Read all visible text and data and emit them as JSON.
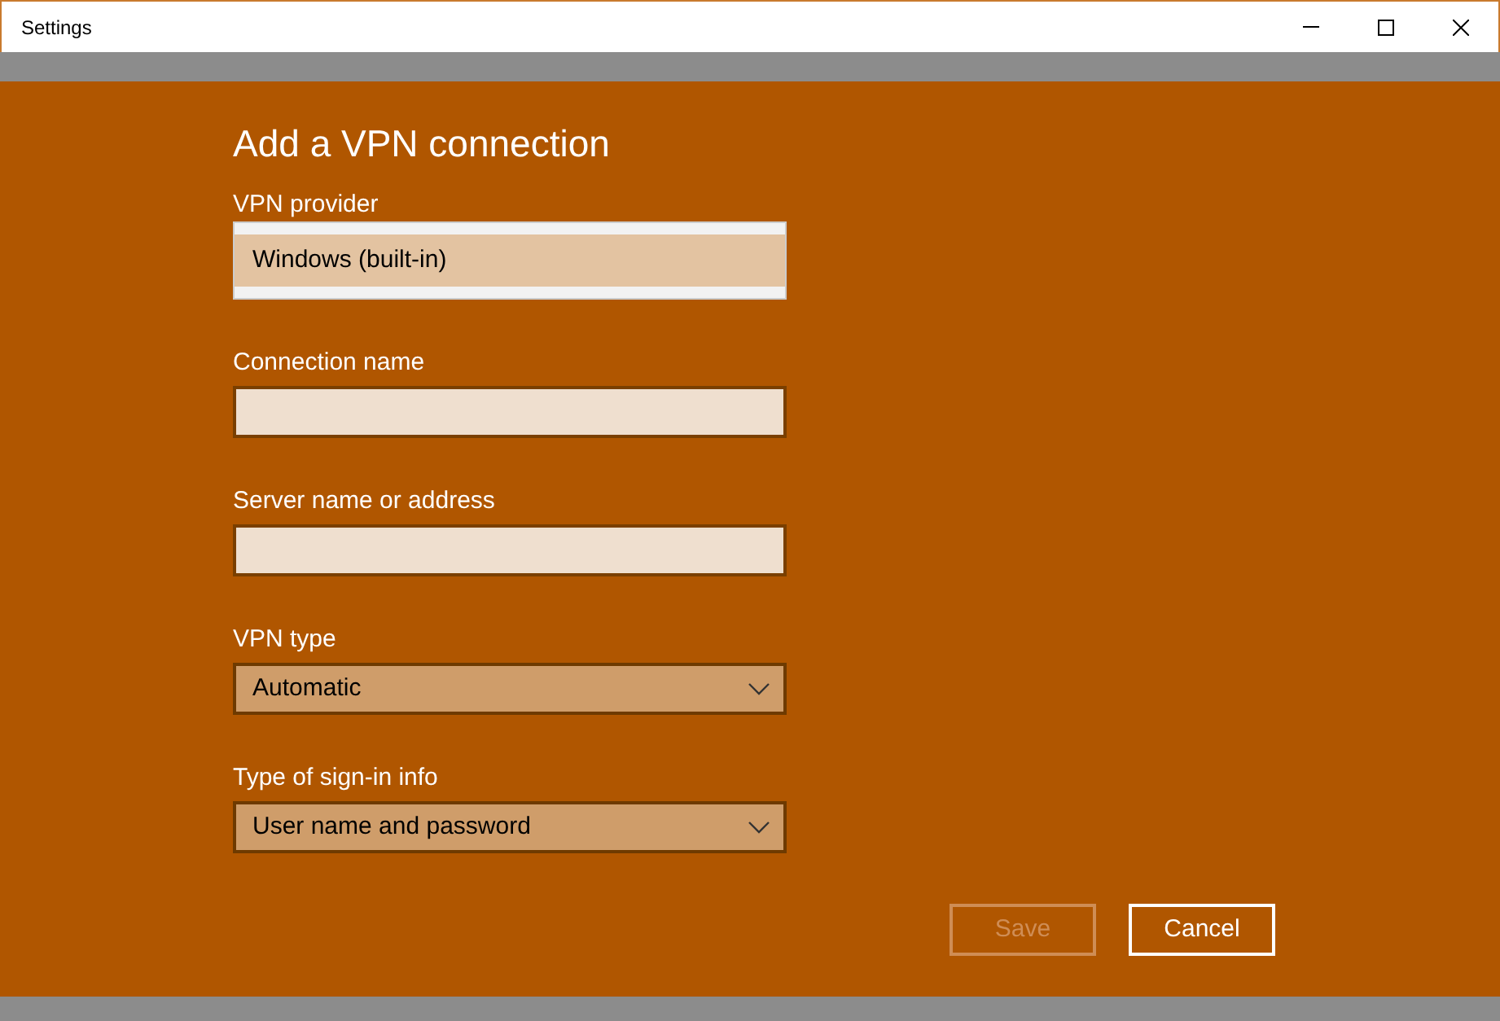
{
  "window": {
    "title": "Settings"
  },
  "heading": "Add a VPN connection",
  "fields": [
    {
      "kind": "list",
      "label": "VPN provider",
      "options": [
        {
          "label": "Windows (built-in)",
          "selected": true
        }
      ]
    },
    {
      "kind": "text",
      "label": "Connection name"
    },
    {
      "kind": "text",
      "label": "Server name or address"
    },
    {
      "kind": "select",
      "label": "VPN type",
      "value": "Automatic"
    },
    {
      "kind": "select",
      "label": "Type of sign-in info",
      "value": "User name and password"
    }
  ],
  "buttons": [
    {
      "label": "Save",
      "disabled": true
    },
    {
      "label": "Cancel",
      "disabled": false
    }
  ]
}
